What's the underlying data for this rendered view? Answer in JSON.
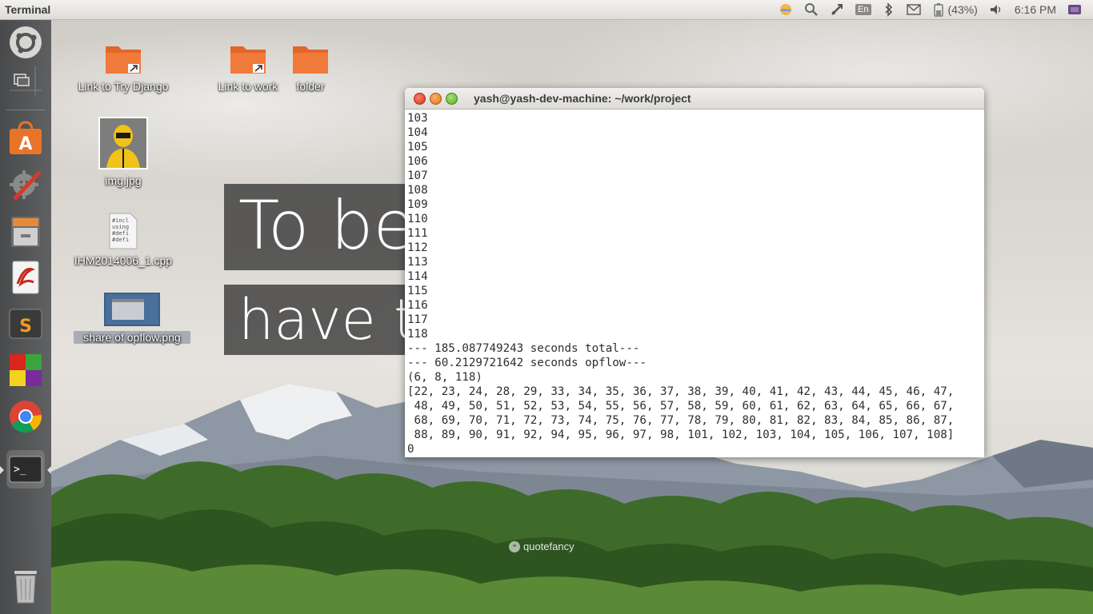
{
  "top_panel": {
    "title": "Terminal",
    "battery": "(43%)",
    "time": "6:16 PM",
    "keyboard_layout": "En",
    "indicator_icons": [
      "weather-icon",
      "search-icon",
      "network-icon",
      "keyboard-icon",
      "bluetooth-icon",
      "mail-icon",
      "battery-icon",
      "volume-icon",
      "session-icon"
    ]
  },
  "launcher": {
    "items": [
      {
        "name": "dash-home",
        "icon": "ubuntu-logo-icon"
      },
      {
        "name": "workspace-switcher",
        "icon": "workspaces-icon"
      },
      {
        "name": "software-center",
        "icon": "software-center-icon"
      },
      {
        "name": "system-settings",
        "icon": "settings-icon"
      },
      {
        "name": "files",
        "icon": "file-cabinet-icon"
      },
      {
        "name": "libreoffice",
        "icon": "document-viewer-icon"
      },
      {
        "name": "sublime-text",
        "icon": "sublime-text-icon"
      },
      {
        "name": "cube-app",
        "icon": "colored-cube-icon"
      },
      {
        "name": "chrome",
        "icon": "chrome-icon"
      },
      {
        "name": "terminal",
        "icon": "terminal-icon"
      },
      {
        "name": "trash",
        "icon": "trash-icon"
      }
    ]
  },
  "desktop_icons": [
    {
      "label": "Link to Try Django",
      "icon": "folder-link-icon"
    },
    {
      "label": "Link to work",
      "icon": "folder-link-icon"
    },
    {
      "label": "folder",
      "icon": "folder-icon"
    },
    {
      "label": "img.jpg",
      "icon": "image-thumbnail-icon"
    },
    {
      "label": "IHM2014006_1.cpp",
      "icon": "cpp-file-icon"
    },
    {
      "label": "share of opflow.png",
      "icon": "screenshot-thumbnail-icon"
    }
  ],
  "wallpaper": {
    "quote_line1": "To be",
    "quote_line2": "have t",
    "brand": "quotefancy"
  },
  "terminal": {
    "title": "yash@yash-dev-machine: ~/work/project",
    "lines": [
      "103",
      "104",
      "105",
      "106",
      "107",
      "108",
      "109",
      "110",
      "111",
      "112",
      "113",
      "114",
      "115",
      "116",
      "117",
      "118",
      "--- 185.087749243 seconds total---",
      "--- 60.2129721642 seconds opflow---",
      "(6, 8, 118)",
      "[22, 23, 24, 28, 29, 33, 34, 35, 36, 37, 38, 39, 40, 41, 42, 43, 44, 45, 46, 47,",
      " 48, 49, 50, 51, 52, 53, 54, 55, 56, 57, 58, 59, 60, 61, 62, 63, 64, 65, 66, 67,",
      " 68, 69, 70, 71, 72, 73, 74, 75, 76, 77, 78, 79, 80, 81, 82, 83, 84, 85, 86, 87,",
      " 88, 89, 90, 91, 92, 94, 95, 96, 97, 98, 101, 102, 103, 104, 105, 106, 107, 108]",
      "0"
    ]
  }
}
